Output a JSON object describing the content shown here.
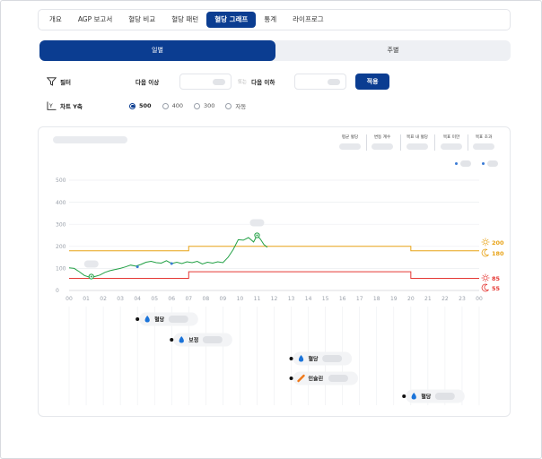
{
  "tabs": [
    {
      "label": "개요",
      "active": false
    },
    {
      "label": "AGP 보고서",
      "active": false
    },
    {
      "label": "혈당 비교",
      "active": false
    },
    {
      "label": "혈당 패턴",
      "active": false
    },
    {
      "label": "혈당 그래프",
      "active": true
    },
    {
      "label": "통계",
      "active": false
    },
    {
      "label": "라이프로그",
      "active": false
    }
  ],
  "view_toggle": {
    "daily": "일별",
    "weekly": "주별",
    "selected": "일별"
  },
  "filter": {
    "label": "필터",
    "min_label": "다음 이상",
    "or_label": "또는",
    "max_label": "다음 이하",
    "apply": "적용",
    "min_value": "",
    "max_value": ""
  },
  "y_axis": {
    "label": "차트 Y축",
    "options": [
      "500",
      "400",
      "300",
      "자동"
    ],
    "selected": "500"
  },
  "stats": [
    {
      "label": "평균 혈당"
    },
    {
      "label": "변동 계수"
    },
    {
      "label": "목표 내 혈당"
    },
    {
      "label": "목표 미만"
    },
    {
      "label": "목표 초과"
    }
  ],
  "chart_data": {
    "type": "line",
    "x_ticks": [
      "00",
      "01",
      "02",
      "03",
      "04",
      "05",
      "06",
      "07",
      "08",
      "09",
      "10",
      "11",
      "12",
      "13",
      "14",
      "15",
      "16",
      "17",
      "18",
      "19",
      "20",
      "21",
      "22",
      "23",
      "00"
    ],
    "y_ticks": [
      0,
      100,
      200,
      300,
      400,
      500
    ],
    "ylim": [
      0,
      500
    ],
    "xlim": [
      0,
      24
    ],
    "series": [
      {
        "type": "glucose",
        "color": "#22a045",
        "x": [
          0,
          0.3,
          0.6,
          0.9,
          1.2,
          1.5,
          1.8,
          2.1,
          2.4,
          2.7,
          3.0,
          3.3,
          3.6,
          3.9,
          4.2,
          4.5,
          4.8,
          5.1,
          5.4,
          5.7,
          6.0,
          6.3,
          6.6,
          6.9,
          7.2,
          7.5,
          7.8,
          8.1,
          8.4,
          8.7,
          9.0,
          9.3,
          9.6,
          9.9,
          10.2,
          10.5,
          10.8,
          11.0,
          11.2,
          11.4,
          11.6
        ],
        "y": [
          103,
          100,
          85,
          68,
          60,
          63,
          70,
          82,
          90,
          95,
          100,
          107,
          115,
          110,
          118,
          128,
          132,
          126,
          124,
          135,
          122,
          128,
          122,
          130,
          126,
          132,
          120,
          128,
          124,
          130,
          126,
          150,
          185,
          230,
          228,
          240,
          220,
          250,
          232,
          208,
          196
        ]
      }
    ],
    "day_upper_threshold": {
      "value": 200,
      "color": "#e8a317",
      "label": "200"
    },
    "night_upper_threshold": {
      "value": 180,
      "color": "#e8a317",
      "label": "180"
    },
    "day_lower_threshold": {
      "value": 85,
      "color": "#e53935",
      "label": "85"
    },
    "night_lower_threshold": {
      "value": 55,
      "color": "#e53935",
      "label": "55"
    },
    "day_period": [
      7,
      20
    ],
    "markers": [
      {
        "x": 1.3,
        "y": 63,
        "kind": "ring"
      },
      {
        "x": 4.0,
        "y": 107,
        "kind": "dot"
      },
      {
        "x": 6.0,
        "y": 122,
        "kind": "dot"
      },
      {
        "x": 11.0,
        "y": 250,
        "kind": "ring"
      }
    ],
    "events": [
      {
        "label": "혈당",
        "time": 4.0,
        "icon": "drop",
        "lane": 0
      },
      {
        "label": "보정",
        "time": 6.0,
        "icon": "drop-pad",
        "lane": 1
      },
      {
        "label": "혈당",
        "time": 13.0,
        "icon": "drop",
        "lane": 2
      },
      {
        "label": "인슐린",
        "time": 13.0,
        "icon": "syringe",
        "lane": 3
      },
      {
        "label": "혈당",
        "time": 19.6,
        "icon": "drop",
        "lane": 4
      }
    ]
  }
}
